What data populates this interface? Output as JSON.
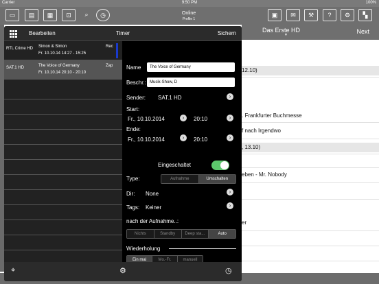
{
  "status": {
    "carrier": "Carrier",
    "time": "9:50 PM",
    "battery": "100%"
  },
  "topbar": {
    "left_icons": [
      "tv-icon",
      "radio-icon",
      "film-icon",
      "monitor-icon",
      "search-icon",
      "history-clock-icon"
    ],
    "right_icons": [
      "contacts-icon",
      "mail-icon",
      "tools-icon",
      "info-icon",
      "settings-icon",
      "clapper-icon"
    ],
    "online": "Online",
    "profile": "Profile 1"
  },
  "epg": {
    "channel": "Das Erste HD",
    "next": "Next",
    "rows": [
      {
        "text": "12.10)",
        "type": "sep"
      },
      {
        "text": ". Frankfurter Buchmesse",
        "type": "item"
      },
      {
        "text": "f nach Irgendwo",
        "type": "item"
      },
      {
        "text": ", 13.10)",
        "type": "sep"
      },
      {
        "text": "eben - Mr. Nobody",
        "type": "item"
      },
      {
        "text": "er",
        "type": "item"
      }
    ]
  },
  "popover": {
    "edit": "Bearbeiten",
    "title": "Timer",
    "save": "Sichern",
    "timers": [
      {
        "channel": "RTL Crime HD",
        "title": "Simon & Simon",
        "date": "Fr. 10.10.14 14:27 - 15:25",
        "status": "Rec"
      },
      {
        "channel": "SAT.1 HD",
        "title": "The Voice of Germany",
        "date": "Fr. 10.10.14 20:10 - 20:10",
        "status": "Zap"
      }
    ],
    "form": {
      "name_label": "Name",
      "name_value": "The Voice of Germany",
      "desc_label": "Beschr.:",
      "desc_value": "Musik-Show, D",
      "sender_label": "Sender:",
      "sender_value": "SAT.1 HD",
      "start_label": "Start:",
      "start_date": "Fr., 10.10.2014",
      "start_time": "20:10",
      "end_label": "Ende:",
      "end_date": "Fr., 10.10.2014",
      "end_time": "20:10",
      "enabled_label": "Eingeschaltet",
      "enabled": true,
      "type_label": "Type:",
      "type_options": [
        "Aufnahme",
        "Umschalten"
      ],
      "type_selected": "Umschalten",
      "dir_label": "Dir:",
      "dir_value": "None",
      "tags_label": "Tags:",
      "tags_value": "Keiner",
      "after_label": "nach der Aufnahme..:",
      "after_options": [
        "Nichts",
        "Standby",
        "Deep sta...",
        "Auto"
      ],
      "after_selected": "Auto",
      "repeat_label": "Wiederholung",
      "repeat_options": [
        "Ein mal",
        "Mo.-Fr.",
        "manuell"
      ],
      "repeat_selected": "Ein mal"
    }
  }
}
